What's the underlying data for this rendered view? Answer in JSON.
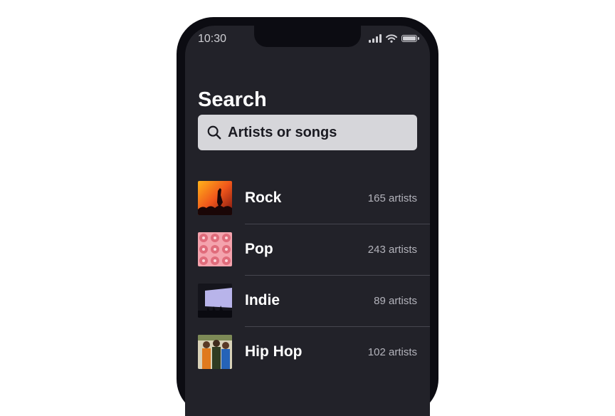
{
  "status": {
    "time": "10:30"
  },
  "header": {
    "title": "Search"
  },
  "search": {
    "placeholder": "Artists or songs"
  },
  "genres": [
    {
      "name": "Rock",
      "count": "165 artists"
    },
    {
      "name": "Pop",
      "count": "243 artists"
    },
    {
      "name": "Indie",
      "count": "89 artists"
    },
    {
      "name": "Hip Hop",
      "count": "102 artists"
    }
  ],
  "colors": {
    "background": "#222229",
    "search_bg": "#d6d6da",
    "accent_text": "#ffffff",
    "muted_text": "#b3b3bb"
  }
}
